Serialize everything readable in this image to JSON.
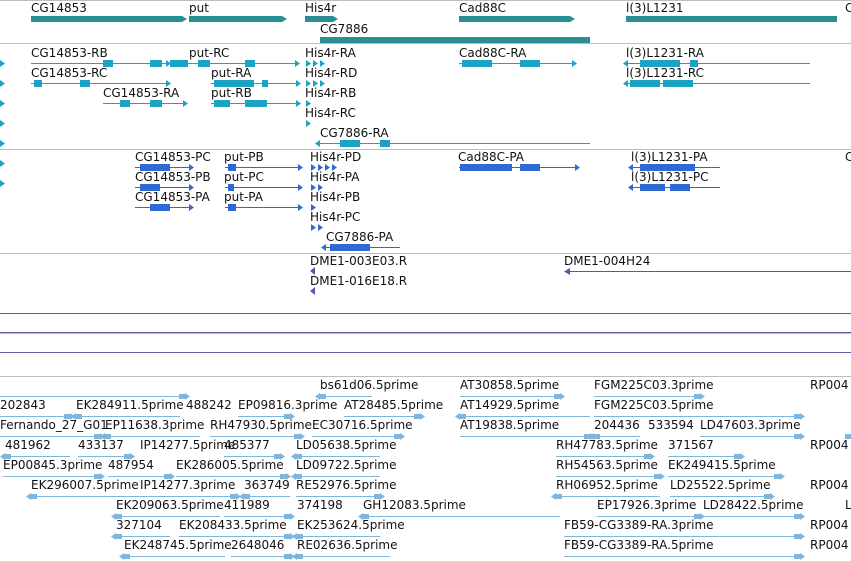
{
  "view": {
    "colors": {
      "gene": "#2a8f93",
      "transcript_a": "#1ba2c4",
      "transcript_b": "#3169d2",
      "clone": "#6a4ea8",
      "est": "#7fb6de",
      "divider": "#bdbdbd",
      "lane_line": "#6b5a9e"
    }
  },
  "tracks": {
    "genes": {
      "labels": [
        "CG14853",
        "put",
        "His4r",
        "Cad88C",
        "l(3)L1231",
        "C",
        "CG7886"
      ]
    },
    "transcripts_upper": {
      "labels": [
        "CG14853-RB",
        "put-RC",
        "His4r-RA",
        "Cad88C-RA",
        "l(3)L1231-RA",
        "CG14853-RC",
        "put-RA",
        "His4r-RD",
        "l(3)L1231-RC",
        "CG14853-RA",
        "put-RB",
        "His4r-RB",
        "His4r-RC",
        "CG7886-RA"
      ]
    },
    "transcripts_lower": {
      "labels": [
        "CG14853-PC",
        "put-PB",
        "His4r-PD",
        "Cad88C-PA",
        "l(3)L1231-PA",
        "C",
        "CG14853-PB",
        "put-PC",
        "His4r-PA",
        "l(3)L1231-PC",
        "CG14853-PA",
        "put-PA",
        "His4r-PB",
        "His4r-PC",
        "CG7886-PA"
      ]
    },
    "clones": {
      "labels": [
        "DME1-003E03.R",
        "DME1-004H24",
        "DME1-016E18.R"
      ]
    },
    "ests": {
      "labels": [
        "bs61d06.5prime",
        "AT30858.5prime",
        "FGM225C03.3prime",
        "RP004",
        "202843",
        "EK284911.5prime",
        "488242",
        "EP09816.3prime",
        "AT28485.5prime",
        "AT14929.5prime",
        "FGM225C03.5prime",
        "Fernando_27_G01",
        "EP11638.3prime",
        "RH47930.5prime",
        "EC30716.5prime",
        "AT19838.5prime",
        "204436",
        "533594",
        "LD47603.3prime",
        "481962",
        "433137",
        "IP14277.5prime",
        "485377",
        "LD05638.5prime",
        "RH47783.5prime",
        "371567",
        "RP004",
        "EP00845.3prime",
        "487954",
        "EK286005.5prime",
        "LD09722.5prime",
        "RH54563.5prime",
        "EK249415.5prime",
        "EK296007.5prime",
        "IP14277.3prime",
        "363749",
        "RE52976.5prime",
        "RH06952.5prime",
        "LD25522.5prime",
        "RP004",
        "EK209063.5prime",
        "411989",
        "374198",
        "GH12083.5prime",
        "EP17926.3prime",
        "LD28422.5prime",
        "L",
        "327104",
        "EK208433.5prime",
        "EK253624.5prime",
        "FB59-CG3389-RA.3prime",
        "RP004",
        "EK248745.5prime",
        "2648046",
        "RE02636.5prime",
        "FB59-CG3389-RA.5prime",
        "RP004"
      ]
    }
  }
}
